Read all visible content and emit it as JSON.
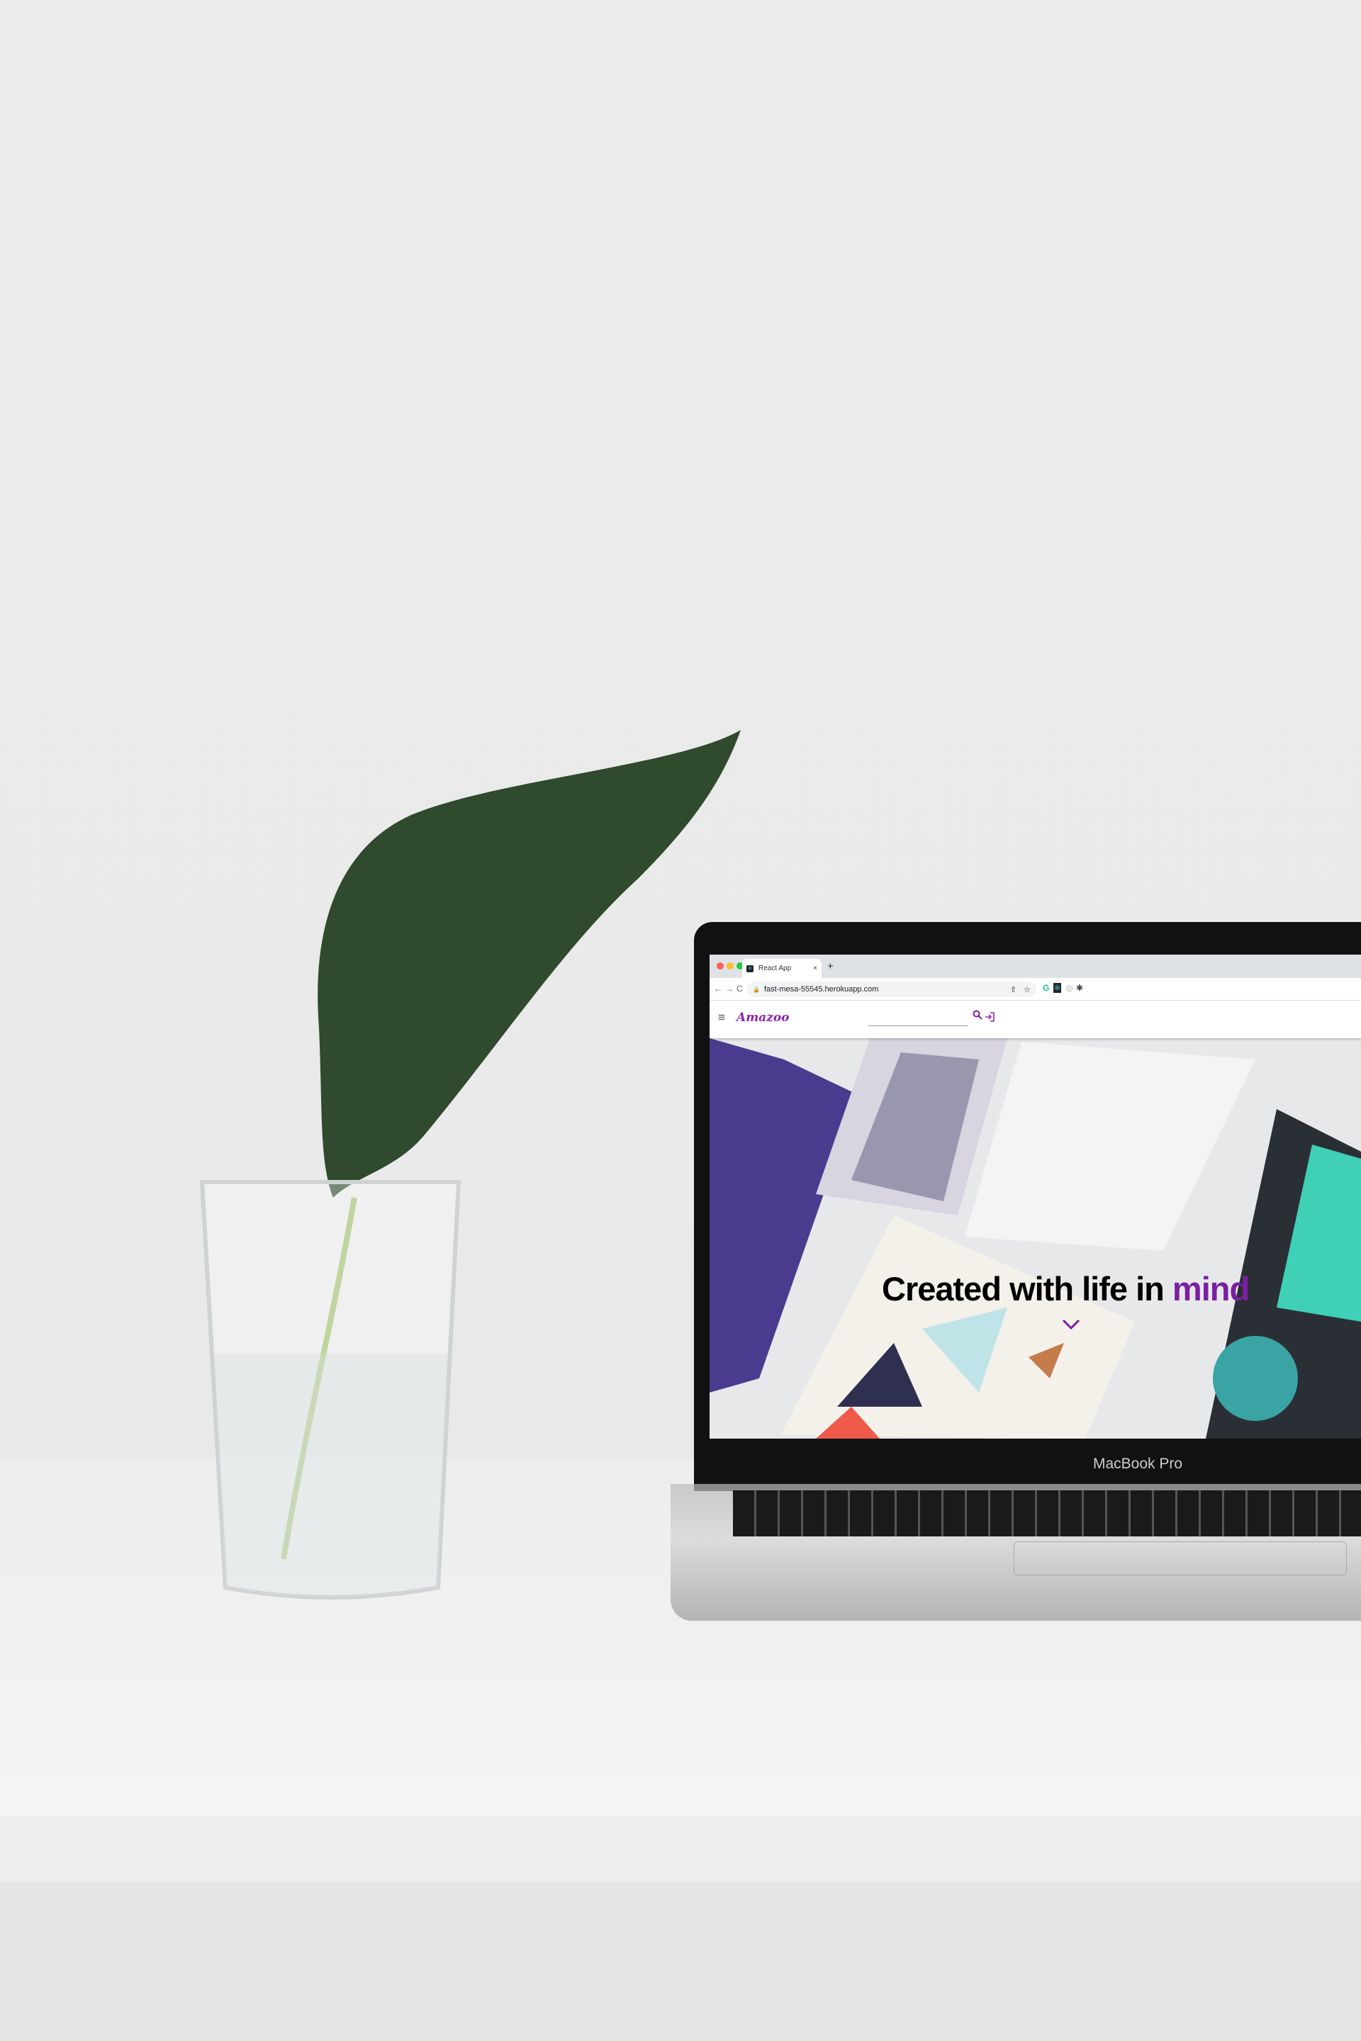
{
  "browser": {
    "tab_title": "React App",
    "tab_icon": "react-icon",
    "new_tab": "+",
    "close_tab": "×",
    "url": "fast-mesa-55545.herokuapp.com",
    "back": "←",
    "forward": "→",
    "reload": "C",
    "share": "⇧",
    "bookmark": "☆",
    "extensions": [
      "G",
      "⚛",
      "◎",
      "✱"
    ]
  },
  "app": {
    "logo": "Amazoo",
    "menu_icon": "≡",
    "search_placeholder": "",
    "search_icon": "search-icon",
    "login_icon": "login-icon",
    "accent": "#8e24aa"
  },
  "hero": {
    "headline_main": "Created with life in ",
    "headline_accent": "mind",
    "accent": "#7b1fa2"
  },
  "device": {
    "label": "MacBook Pro"
  }
}
